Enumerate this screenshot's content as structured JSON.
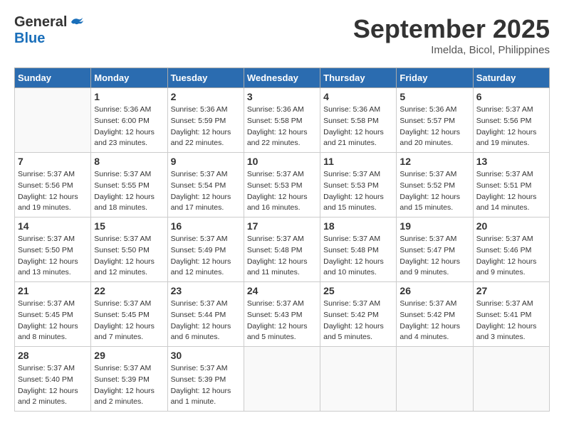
{
  "header": {
    "logo_general": "General",
    "logo_blue": "Blue",
    "month_title": "September 2025",
    "location": "Imelda, Bicol, Philippines"
  },
  "columns": [
    "Sunday",
    "Monday",
    "Tuesday",
    "Wednesday",
    "Thursday",
    "Friday",
    "Saturday"
  ],
  "weeks": [
    [
      {
        "day": "",
        "info": ""
      },
      {
        "day": "1",
        "info": "Sunrise: 5:36 AM\nSunset: 6:00 PM\nDaylight: 12 hours\nand 23 minutes."
      },
      {
        "day": "2",
        "info": "Sunrise: 5:36 AM\nSunset: 5:59 PM\nDaylight: 12 hours\nand 22 minutes."
      },
      {
        "day": "3",
        "info": "Sunrise: 5:36 AM\nSunset: 5:58 PM\nDaylight: 12 hours\nand 22 minutes."
      },
      {
        "day": "4",
        "info": "Sunrise: 5:36 AM\nSunset: 5:58 PM\nDaylight: 12 hours\nand 21 minutes."
      },
      {
        "day": "5",
        "info": "Sunrise: 5:36 AM\nSunset: 5:57 PM\nDaylight: 12 hours\nand 20 minutes."
      },
      {
        "day": "6",
        "info": "Sunrise: 5:37 AM\nSunset: 5:56 PM\nDaylight: 12 hours\nand 19 minutes."
      }
    ],
    [
      {
        "day": "7",
        "info": "Sunrise: 5:37 AM\nSunset: 5:56 PM\nDaylight: 12 hours\nand 19 minutes."
      },
      {
        "day": "8",
        "info": "Sunrise: 5:37 AM\nSunset: 5:55 PM\nDaylight: 12 hours\nand 18 minutes."
      },
      {
        "day": "9",
        "info": "Sunrise: 5:37 AM\nSunset: 5:54 PM\nDaylight: 12 hours\nand 17 minutes."
      },
      {
        "day": "10",
        "info": "Sunrise: 5:37 AM\nSunset: 5:53 PM\nDaylight: 12 hours\nand 16 minutes."
      },
      {
        "day": "11",
        "info": "Sunrise: 5:37 AM\nSunset: 5:53 PM\nDaylight: 12 hours\nand 15 minutes."
      },
      {
        "day": "12",
        "info": "Sunrise: 5:37 AM\nSunset: 5:52 PM\nDaylight: 12 hours\nand 15 minutes."
      },
      {
        "day": "13",
        "info": "Sunrise: 5:37 AM\nSunset: 5:51 PM\nDaylight: 12 hours\nand 14 minutes."
      }
    ],
    [
      {
        "day": "14",
        "info": "Sunrise: 5:37 AM\nSunset: 5:50 PM\nDaylight: 12 hours\nand 13 minutes."
      },
      {
        "day": "15",
        "info": "Sunrise: 5:37 AM\nSunset: 5:50 PM\nDaylight: 12 hours\nand 12 minutes."
      },
      {
        "day": "16",
        "info": "Sunrise: 5:37 AM\nSunset: 5:49 PM\nDaylight: 12 hours\nand 12 minutes."
      },
      {
        "day": "17",
        "info": "Sunrise: 5:37 AM\nSunset: 5:48 PM\nDaylight: 12 hours\nand 11 minutes."
      },
      {
        "day": "18",
        "info": "Sunrise: 5:37 AM\nSunset: 5:48 PM\nDaylight: 12 hours\nand 10 minutes."
      },
      {
        "day": "19",
        "info": "Sunrise: 5:37 AM\nSunset: 5:47 PM\nDaylight: 12 hours\nand 9 minutes."
      },
      {
        "day": "20",
        "info": "Sunrise: 5:37 AM\nSunset: 5:46 PM\nDaylight: 12 hours\nand 9 minutes."
      }
    ],
    [
      {
        "day": "21",
        "info": "Sunrise: 5:37 AM\nSunset: 5:45 PM\nDaylight: 12 hours\nand 8 minutes."
      },
      {
        "day": "22",
        "info": "Sunrise: 5:37 AM\nSunset: 5:45 PM\nDaylight: 12 hours\nand 7 minutes."
      },
      {
        "day": "23",
        "info": "Sunrise: 5:37 AM\nSunset: 5:44 PM\nDaylight: 12 hours\nand 6 minutes."
      },
      {
        "day": "24",
        "info": "Sunrise: 5:37 AM\nSunset: 5:43 PM\nDaylight: 12 hours\nand 5 minutes."
      },
      {
        "day": "25",
        "info": "Sunrise: 5:37 AM\nSunset: 5:42 PM\nDaylight: 12 hours\nand 5 minutes."
      },
      {
        "day": "26",
        "info": "Sunrise: 5:37 AM\nSunset: 5:42 PM\nDaylight: 12 hours\nand 4 minutes."
      },
      {
        "day": "27",
        "info": "Sunrise: 5:37 AM\nSunset: 5:41 PM\nDaylight: 12 hours\nand 3 minutes."
      }
    ],
    [
      {
        "day": "28",
        "info": "Sunrise: 5:37 AM\nSunset: 5:40 PM\nDaylight: 12 hours\nand 2 minutes."
      },
      {
        "day": "29",
        "info": "Sunrise: 5:37 AM\nSunset: 5:39 PM\nDaylight: 12 hours\nand 2 minutes."
      },
      {
        "day": "30",
        "info": "Sunrise: 5:37 AM\nSunset: 5:39 PM\nDaylight: 12 hours\nand 1 minute."
      },
      {
        "day": "",
        "info": ""
      },
      {
        "day": "",
        "info": ""
      },
      {
        "day": "",
        "info": ""
      },
      {
        "day": "",
        "info": ""
      }
    ]
  ]
}
